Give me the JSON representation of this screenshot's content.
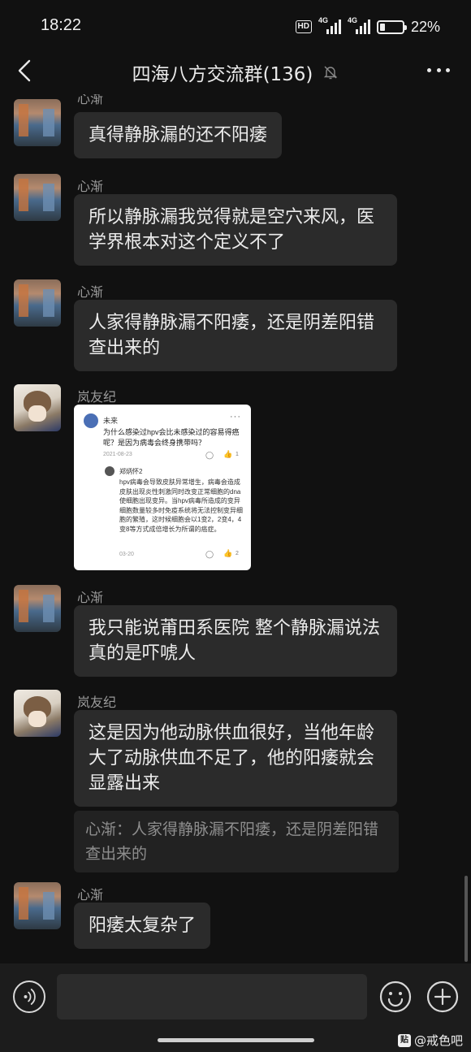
{
  "status_bar": {
    "time": "18:22",
    "hd_label": "HD",
    "network_1": "4G",
    "network_2": "4G",
    "battery": "22%",
    "battery_level": 0.22
  },
  "header": {
    "title": "四海八方交流群(136)",
    "icons": [
      "back-icon",
      "mute-bell-icon",
      "more-icon"
    ]
  },
  "messages": [
    {
      "sender": "心渐",
      "text": "真得静脉漏的还不阳痿"
    },
    {
      "sender": "心渐",
      "text": "所以静脉漏我觉得就是空穴来风，医学界根本对这个定义不了"
    },
    {
      "sender": "心渐",
      "text": "人家得静脉漏不阳痿，还是阴差阳错查出来的"
    },
    {
      "sender": "岚友纪",
      "card": {
        "user": "未来",
        "menu": "···",
        "question": "为什么感染过hpv会比未感染过的容易得癌呢？是因为病毒会终身携带吗？",
        "date": "2021-08-23",
        "likes": "1",
        "answer_user": "郑炳怀2",
        "answer": "hpv病毒会导致皮肤异常增生，病毒会造成皮肤出现炎性刺激同时改变正常细胞的dna使细胞出现变异。当hpv病毒所造成的变异细胞数量较多时免疫系统将无法控制变异细胞的繁殖，这时候细胞会以1变2，2变4，4变8等方式成倍增长为所谓的癌症。",
        "answer_date": "03-20",
        "answer_likes": "2"
      }
    },
    {
      "sender": "心渐",
      "text": "我只能说莆田系医院 整个静脉漏说法真的是吓唬人"
    },
    {
      "sender": "岚友纪",
      "text": "这是因为他动脉供血很好，当他年龄大了动脉供血不足了，他的阳痿就会显露出来",
      "quote": "心渐：人家得静脉漏不阳痿，还是阴差阳错查出来的"
    },
    {
      "sender": "心渐",
      "text": "阳痿太复杂了"
    }
  ],
  "input_bar": {
    "placeholder": "",
    "icons": [
      "voice-icon",
      "emoji-icon",
      "plus-icon"
    ]
  },
  "watermark": {
    "logo": "贴",
    "text": "@戒色吧"
  }
}
